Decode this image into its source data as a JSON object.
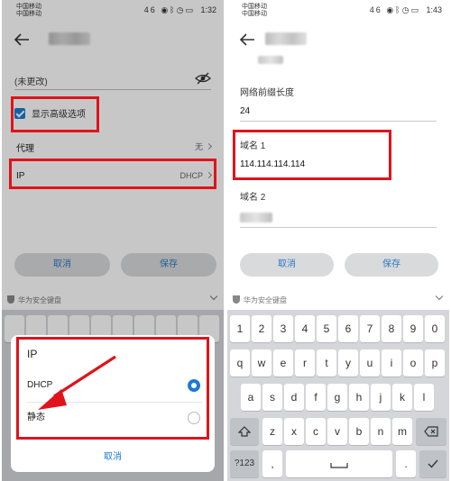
{
  "left": {
    "status": {
      "carrier_1": "中国移动",
      "carrier_2": "中国移动",
      "network": "46",
      "time": "1:32"
    },
    "password_field": {
      "value": "(未更改)",
      "icon": "eye-hidden-icon"
    },
    "advanced_option": {
      "label": "显示高级选项",
      "checked": true
    },
    "proxy": {
      "label": "代理",
      "value": "无"
    },
    "ip": {
      "label": "IP",
      "value": "DHCP"
    },
    "buttons": {
      "cancel": "取消",
      "save": "保存"
    },
    "keyboard_bar": {
      "label": "华为安全键盘"
    },
    "dialog": {
      "title": "IP",
      "options": [
        {
          "label": "DHCP",
          "selected": true
        },
        {
          "label": "静态",
          "selected": false
        }
      ],
      "cancel": "取消"
    }
  },
  "right": {
    "status": {
      "carrier_1": "中国移动",
      "carrier_2": "中国移动",
      "network": "46",
      "time": "1:43"
    },
    "fields": {
      "prefix_label": "网络前缀长度",
      "prefix_value": "24",
      "dns1_label": "域名 1",
      "dns1_value": "114.114.114.114",
      "dns2_label": "域名 2"
    },
    "buttons": {
      "cancel": "取消",
      "save": "保存"
    },
    "keyboard_bar": {
      "label": "华为安全键盘"
    },
    "keyboard": {
      "row1": [
        "1",
        "2",
        "3",
        "4",
        "5",
        "6",
        "7",
        "8",
        "9",
        "0"
      ],
      "row2": [
        "q",
        "w",
        "e",
        "r",
        "t",
        "y",
        "u",
        "i",
        "o",
        "p"
      ],
      "row3": [
        "a",
        "s",
        "d",
        "f",
        "g",
        "h",
        "j",
        "k",
        "l"
      ],
      "row4": [
        "z",
        "x",
        "c",
        "v",
        "b",
        "n",
        "m"
      ],
      "row5": [
        "?123",
        ",",
        "."
      ]
    }
  },
  "colors": {
    "accent": "#1a7bd6",
    "highlight": "#e0131b"
  }
}
